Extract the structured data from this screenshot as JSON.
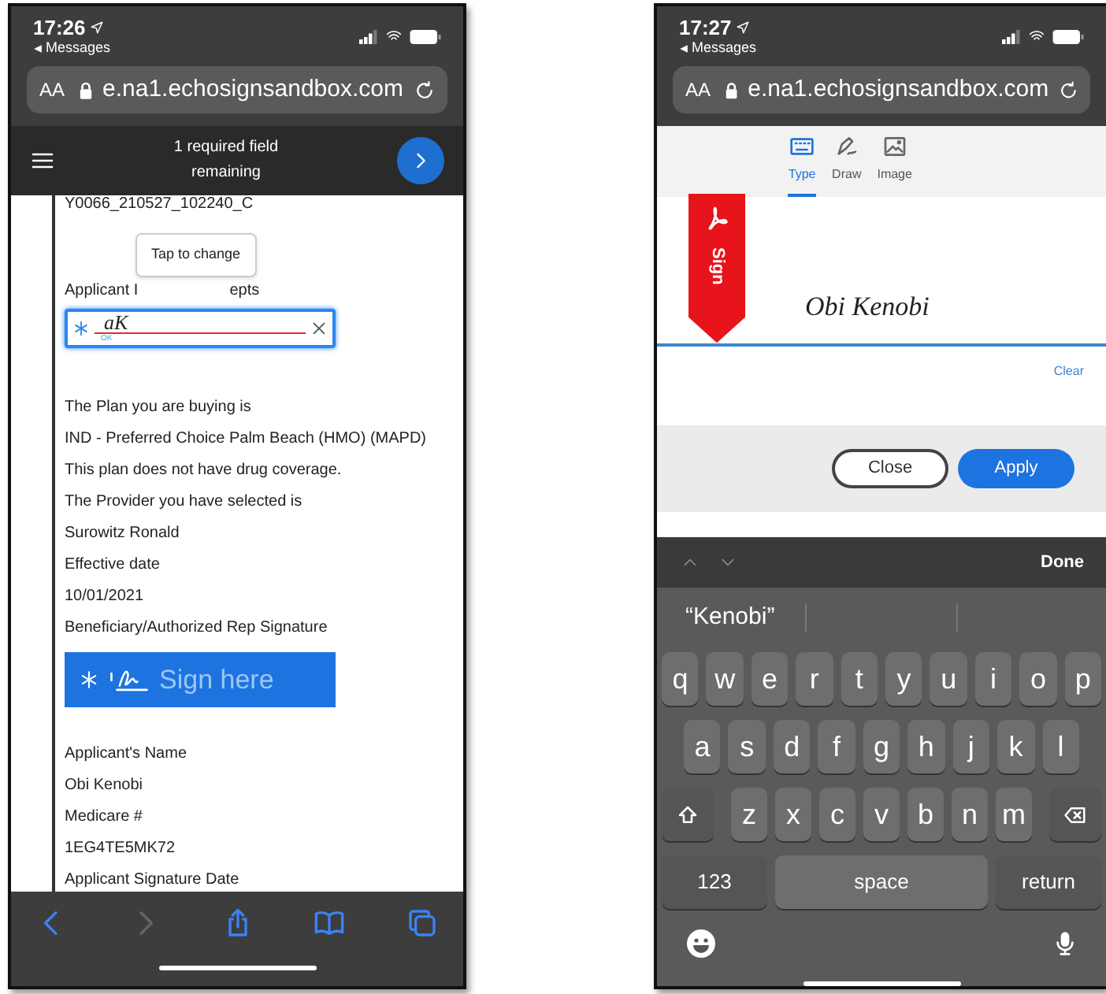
{
  "left_phone": {
    "status_bar": {
      "time": "17:26",
      "back_app": "Messages"
    },
    "address_bar": {
      "text_size": "AA",
      "url": "e.na1.echosignsandbox.com"
    },
    "header": {
      "message_lines": [
        "1 required field",
        "remaining"
      ]
    },
    "document": {
      "cut_line": "Y0066_210527_102240_C",
      "label_parts": [
        "Applicant I",
        "epts"
      ],
      "tooltip": "Tap to change",
      "initials_field": {
        "value": "aK",
        "required": true,
        "status": "OK"
      },
      "lines_before": [
        "The Plan you are buying is",
        "IND - Preferred Choice Palm Beach (HMO) (MAPD)",
        "This plan does not have drug coverage.",
        "The Provider you have selected is",
        "Surowitz Ronald",
        "Effective date",
        "10/01/2021",
        "Beneficiary/Authorized Rep Signature"
      ],
      "sign_field": {
        "label": "Sign here",
        "required": true
      },
      "lines_after": [
        "Applicant's Name",
        "Obi Kenobi",
        "Medicare #",
        "1EG4TE5MK72",
        "Applicant Signature Date"
      ]
    },
    "toolbar": [
      {
        "kind": "back",
        "disabled": false
      },
      {
        "kind": "forward",
        "disabled": true
      },
      {
        "kind": "share",
        "disabled": false
      },
      {
        "kind": "bookmarks",
        "disabled": false
      },
      {
        "kind": "tabs",
        "disabled": false
      }
    ]
  },
  "right_phone": {
    "status_bar": {
      "time": "17:27",
      "back_app": "Messages"
    },
    "address_bar": {
      "text_size": "AA",
      "url": "e.na1.echosignsandbox.com"
    },
    "signature_tabs": [
      {
        "label": "Type",
        "kind": "keyboard",
        "selected": true
      },
      {
        "label": "Draw",
        "kind": "pen",
        "selected": false
      },
      {
        "label": "Image",
        "kind": "image",
        "selected": false
      }
    ],
    "ribbon_label": "Sign",
    "signature": "Obi Kenobi",
    "clear": "Clear",
    "buttons": [
      {
        "label": "Close",
        "kind": "secondary"
      },
      {
        "label": "Apply",
        "kind": "primary"
      }
    ],
    "accessory_bar": {
      "done": "Done"
    },
    "suggestions": [
      "“Kenobi”"
    ],
    "keyboard": [
      [
        {
          "kind": "letter",
          "label": "q"
        },
        {
          "kind": "letter",
          "label": "w"
        },
        {
          "kind": "letter",
          "label": "e"
        },
        {
          "kind": "letter",
          "label": "r"
        },
        {
          "kind": "letter",
          "label": "t"
        },
        {
          "kind": "letter",
          "label": "y"
        },
        {
          "kind": "letter",
          "label": "u"
        },
        {
          "kind": "letter",
          "label": "i"
        },
        {
          "kind": "letter",
          "label": "o"
        },
        {
          "kind": "letter",
          "label": "p"
        }
      ],
      [
        {
          "kind": "letter",
          "label": "a"
        },
        {
          "kind": "letter",
          "label": "s"
        },
        {
          "kind": "letter",
          "label": "d"
        },
        {
          "kind": "letter",
          "label": "f"
        },
        {
          "kind": "letter",
          "label": "g"
        },
        {
          "kind": "letter",
          "label": "h"
        },
        {
          "kind": "letter",
          "label": "j"
        },
        {
          "kind": "letter",
          "label": "k"
        },
        {
          "kind": "letter",
          "label": "l"
        }
      ],
      [
        {
          "kind": "shift"
        },
        {
          "kind": "letter",
          "label": "z"
        },
        {
          "kind": "letter",
          "label": "x"
        },
        {
          "kind": "letter",
          "label": "c"
        },
        {
          "kind": "letter",
          "label": "v"
        },
        {
          "kind": "letter",
          "label": "b"
        },
        {
          "kind": "letter",
          "label": "n"
        },
        {
          "kind": "letter",
          "label": "m"
        },
        {
          "kind": "delete"
        }
      ],
      [
        {
          "kind": "numbers",
          "label": "123"
        },
        {
          "kind": "space",
          "label": "space"
        },
        {
          "kind": "return",
          "label": "return"
        }
      ]
    ]
  }
}
